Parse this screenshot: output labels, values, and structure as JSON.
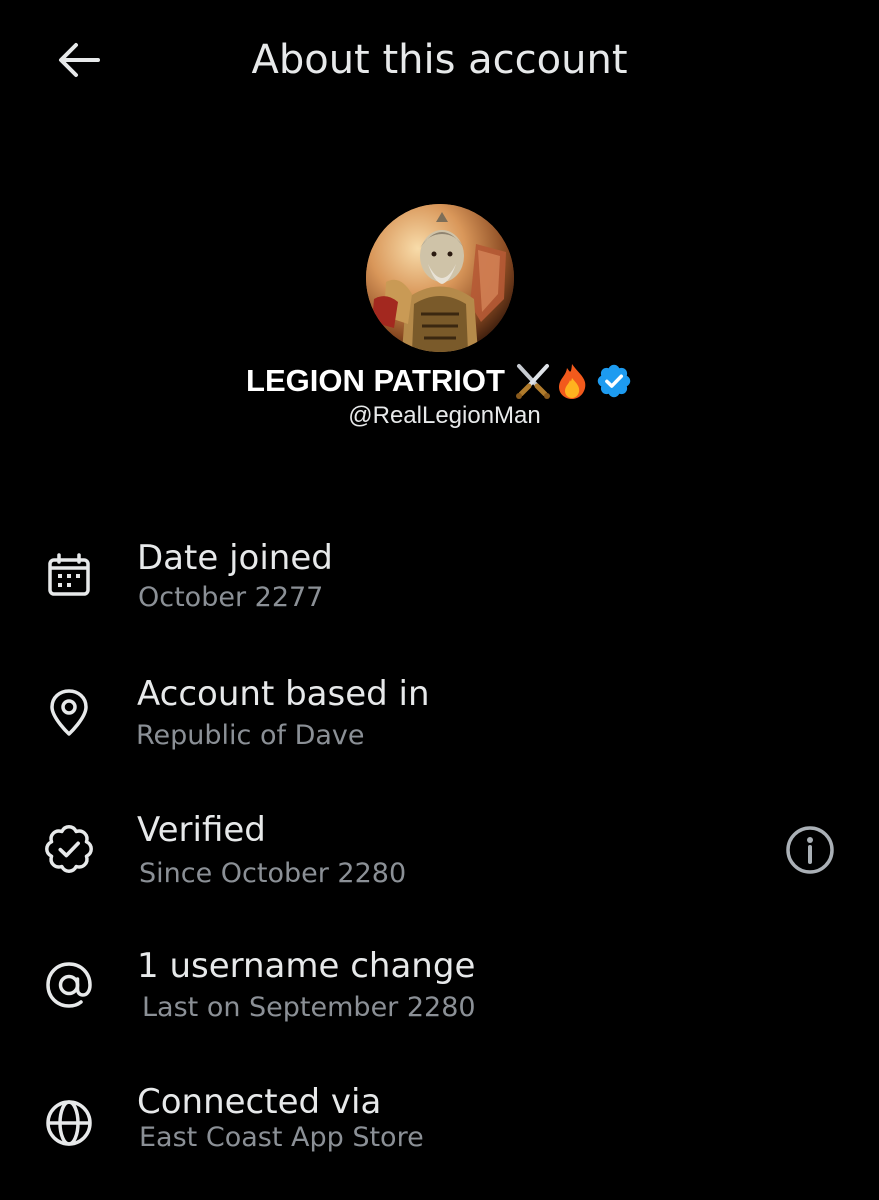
{
  "header": {
    "title": "About this account",
    "back_icon": "arrow-left-icon"
  },
  "profile": {
    "display_name": "LEGION PATRIOT",
    "name_emojis": [
      "⚔️",
      "🔥"
    ],
    "verified_badge_color": "#1d9bf0",
    "handle": "@RealLegionMan"
  },
  "details": [
    {
      "icon": "calendar-icon",
      "title": "Date joined",
      "subtitle": "October 2277"
    },
    {
      "icon": "location-pin-icon",
      "title": "Account based in",
      "subtitle": "Republic of Dave"
    },
    {
      "icon": "verified-badge-icon",
      "title": "Verified",
      "subtitle": "Since October 2280",
      "has_info": true
    },
    {
      "icon": "at-sign-icon",
      "title": "1 username change",
      "subtitle": "Last on September 2280"
    },
    {
      "icon": "globe-icon",
      "title": "Connected via",
      "subtitle": "East Coast App Store"
    }
  ],
  "colors": {
    "background": "#000000",
    "primary_text": "#e7e9ea",
    "secondary_text": "#8b9096",
    "icon": "#e7e9ea"
  }
}
